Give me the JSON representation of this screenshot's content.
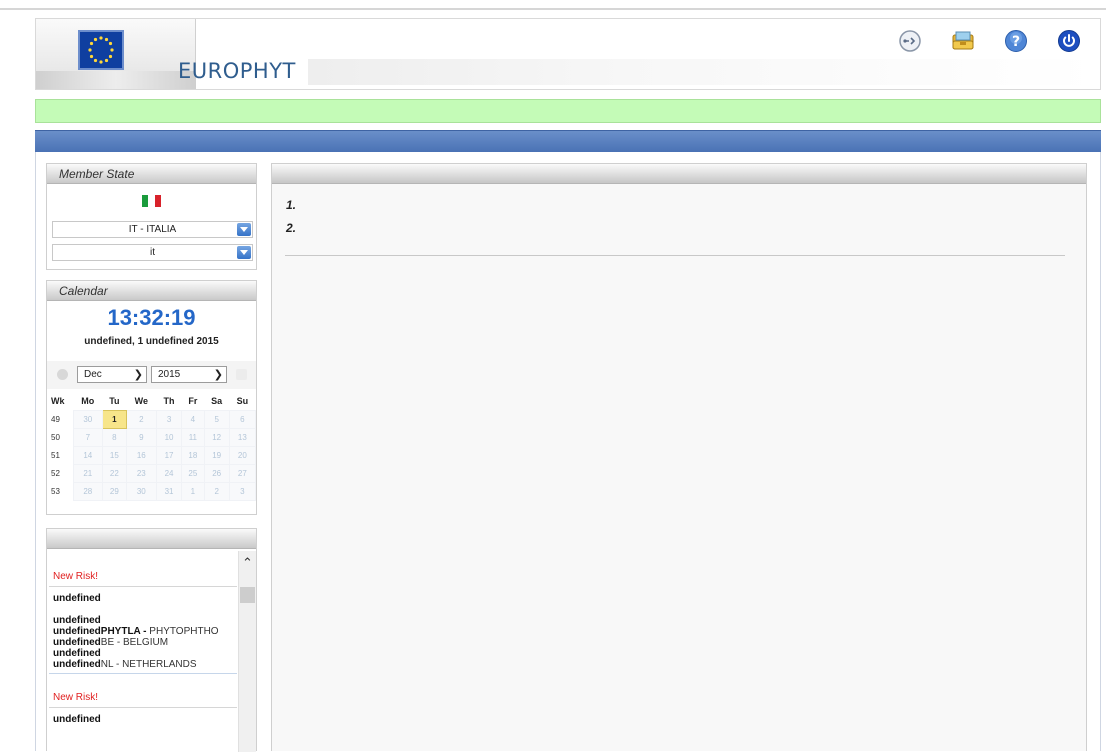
{
  "header": {
    "title": "EUROPHYT",
    "icons": [
      "network-icon",
      "inbox-icon",
      "help-icon",
      "power-icon"
    ]
  },
  "member_state": {
    "heading": "Member State",
    "country_value": "IT - ITALIA",
    "language_value": "it"
  },
  "calendar": {
    "heading": "Calendar",
    "time": "13:32:19",
    "date_text": "undefined, 1 undefined 2015",
    "month_value": "Dec",
    "year_value": "2015",
    "headers": [
      "Wk",
      "Mo",
      "Tu",
      "We",
      "Th",
      "Fr",
      "Sa",
      "Su"
    ],
    "weeks": [
      {
        "wk": "49",
        "days": [
          "30",
          "1",
          "2",
          "3",
          "4",
          "5",
          "6"
        ]
      },
      {
        "wk": "50",
        "days": [
          "7",
          "8",
          "9",
          "10",
          "11",
          "12",
          "13"
        ]
      },
      {
        "wk": "51",
        "days": [
          "14",
          "15",
          "16",
          "17",
          "18",
          "19",
          "20"
        ]
      },
      {
        "wk": "52",
        "days": [
          "21",
          "22",
          "23",
          "24",
          "25",
          "26",
          "27"
        ]
      },
      {
        "wk": "53",
        "days": [
          "28",
          "29",
          "30",
          "31",
          "1",
          "2",
          "3"
        ]
      }
    ],
    "today": "1"
  },
  "risks": {
    "heading": "",
    "items": [
      {
        "title": "New Risk!",
        "lines": [
          {
            "bold": "undefined",
            "light": ""
          },
          {
            "bold": "",
            "light": ""
          },
          {
            "bold": "undefined",
            "light": ""
          },
          {
            "bold": "undefinedPHYTLA - ",
            "light": "PHYTOPHTHO"
          },
          {
            "bold": "undefined",
            "light": "BE - BELGIUM"
          },
          {
            "bold": "undefined",
            "light": ""
          },
          {
            "bold": "undefined",
            "light": "NL - NETHERLANDS"
          }
        ]
      },
      {
        "title": "New Risk!",
        "lines": [
          {
            "bold": "undefined",
            "light": ""
          }
        ]
      }
    ]
  },
  "main": {
    "heading": "",
    "items": [
      "1.",
      "2."
    ]
  },
  "colors": {
    "green_bar": "#c4fbb7",
    "blue_bar": "#4a72b5",
    "clock": "#2467c8",
    "risk_title": "#e01f1f",
    "today": "#f7e58a"
  }
}
